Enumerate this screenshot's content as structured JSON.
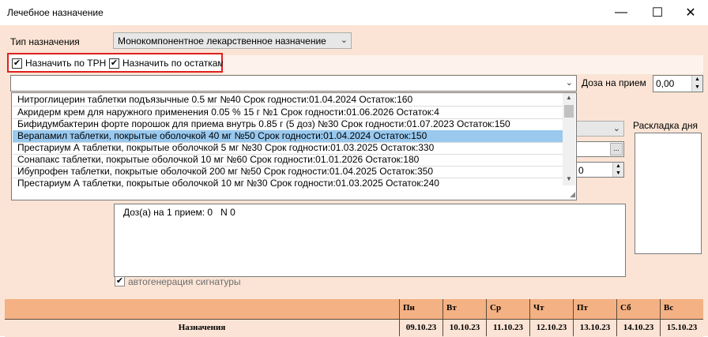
{
  "window": {
    "title": "Лечебное назначение",
    "minimize_glyph": "—",
    "maximize_glyph": "☐",
    "close_glyph": "✕"
  },
  "form": {
    "type_label": "Тип назначения",
    "type_value": "Монокомпонентное лекарственное назначение",
    "assign_trn_label": "Назначить по ТРН",
    "assign_stock_label": "Назначить по остаткам",
    "dose_label": "Доза на прием",
    "dose_value": "0,00",
    "layout_label": "Раскладка дня",
    "partial_value": "0",
    "ellipsis": "...",
    "signature_text": "Доз(а) на 1 прием: 0   N 0",
    "autogen_label": "автогенерация сигнатуры"
  },
  "drug_list": [
    "Нитроглицерин таблетки подъязычные 0.5 мг №40 Срок годности:01.04.2024 Остаток:160",
    "Акридерм крем для наружного применения 0.05 % 15 г №1 Срок годности:01.06.2026 Остаток:4",
    "Бифидумбактерин форте порошок для приема внутрь 0.85 г (5 доз) №30 Срок годности:01.07.2023 Остаток:150",
    "Верапамил таблетки, покрытые оболочкой 40 мг №50 Срок годности:01.04.2024 Остаток:150",
    "Престариум А таблетки, покрытые оболочкой 5 мг №30 Срок годности:01.03.2025 Остаток:330",
    "Сонапакс таблетки, покрытые оболочкой 10 мг №60 Срок годности:01.01.2026 Остаток:180",
    "Ибупрофен таблетки, покрытые оболочкой 200 мг №50 Срок годности:01.04.2025 Остаток:350",
    "Престариум А таблетки, покрытые оболочкой 10 мг №30 Срок годности:01.03.2025 Остаток:240"
  ],
  "selected_index": 3,
  "schedule": {
    "row_label": "Назначения",
    "days": [
      "Пн",
      "Вт",
      "Ср",
      "Чт",
      "Пт",
      "Сб",
      "Вс"
    ],
    "dates": [
      "09.10.23",
      "10.10.23",
      "11.10.23",
      "12.10.23",
      "13.10.23",
      "14.10.23",
      "15.10.23"
    ]
  },
  "colors": {
    "form_bg": "#fbe4d5",
    "grid_header": "#f4b183",
    "grid_row": "#fbe4d5",
    "selection": "#99c9ef",
    "highlight_border": "#e02020"
  }
}
